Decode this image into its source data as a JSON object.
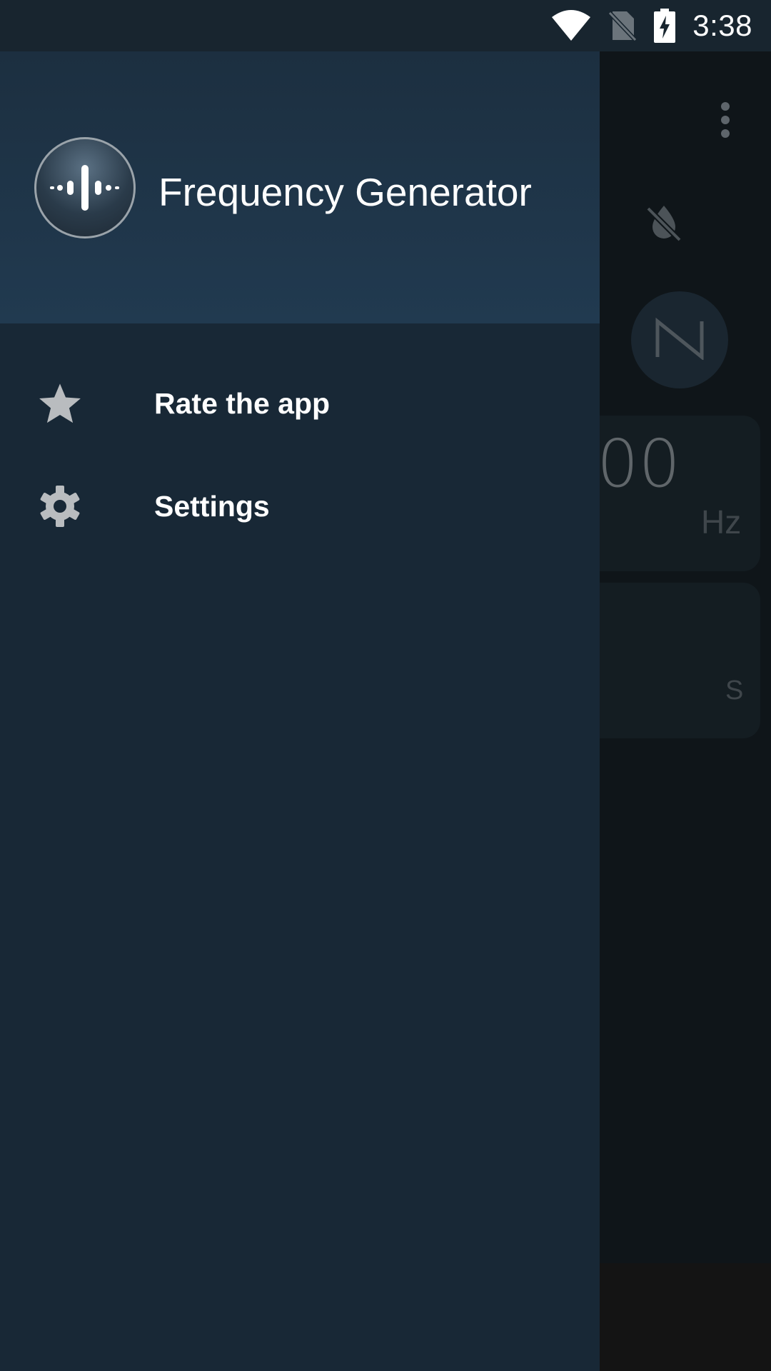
{
  "status_bar": {
    "time": "3:38",
    "icons": [
      "wifi-icon",
      "no-sim-icon",
      "battery-charging-icon"
    ]
  },
  "drawer": {
    "app_title": "Frequency Generator",
    "logo_icon": "waveform-logo-icon",
    "items": [
      {
        "label": "Rate the app",
        "icon": "star-icon"
      },
      {
        "label": "Settings",
        "icon": "gear-icon"
      }
    ]
  },
  "background_app": {
    "frequency_value_partial": "00",
    "frequency_unit": "Hz",
    "duration_unit": "S",
    "icons": [
      "overflow-menu-icon",
      "mute-icon",
      "sawtooth-wave-icon"
    ]
  },
  "colors": {
    "status_bar": "#18252f",
    "drawer_bg": "#182836",
    "drawer_header_bg": "#213a50",
    "icon_gray": "#b9bcbf"
  }
}
